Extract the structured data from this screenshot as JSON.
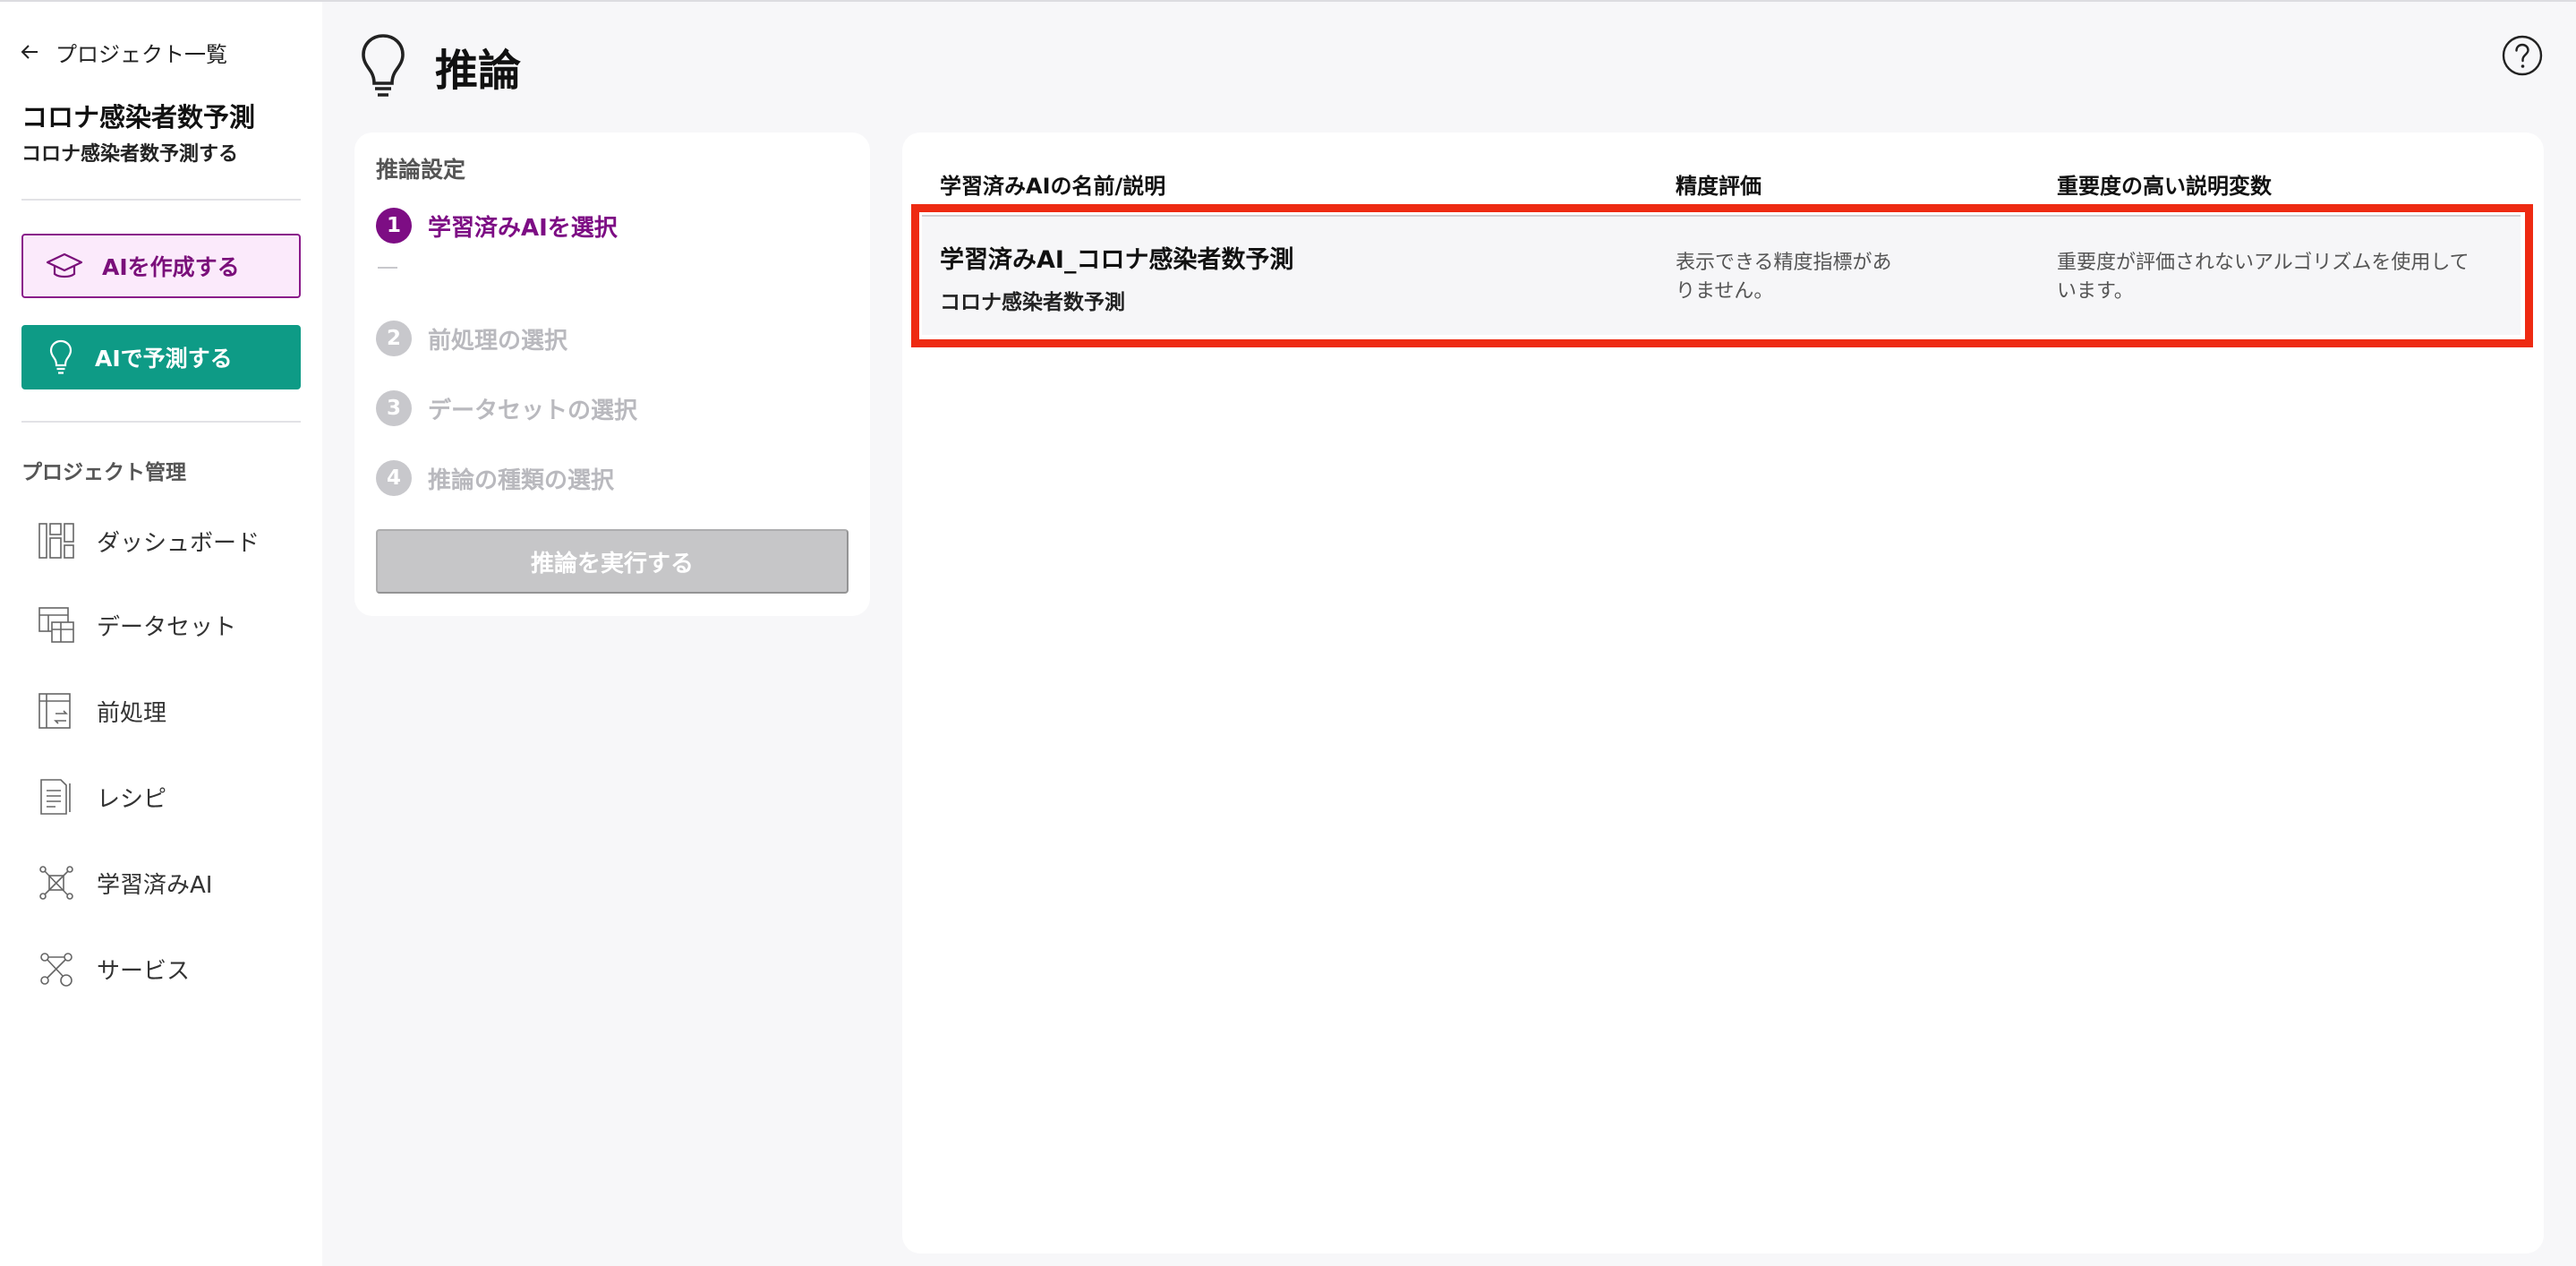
{
  "sidebar": {
    "back_label": "プロジェクト一覧",
    "project_name": "コロナ感染者数予測",
    "project_description": "コロナ感染者数予測する",
    "create_ai_label": "AIを作成する",
    "predict_ai_label": "AIで予測する",
    "section_label": "プロジェクト管理",
    "nav": [
      {
        "label": "ダッシュボード",
        "icon": "dashboard-icon"
      },
      {
        "label": "データセット",
        "icon": "dataset-icon"
      },
      {
        "label": "前処理",
        "icon": "preprocess-icon"
      },
      {
        "label": "レシピ",
        "icon": "recipe-icon"
      },
      {
        "label": "学習済みAI",
        "icon": "trained-ai-icon"
      },
      {
        "label": "サービス",
        "icon": "service-icon"
      }
    ]
  },
  "header": {
    "title": "推論",
    "icon": "lightbulb-icon"
  },
  "settings": {
    "title": "推論設定",
    "steps": [
      {
        "num": "1",
        "label": "学習済みAIを選択",
        "state": "active"
      },
      {
        "num": "2",
        "label": "前処理の選択",
        "state": "inactive"
      },
      {
        "num": "3",
        "label": "データセットの選択",
        "state": "inactive"
      },
      {
        "num": "4",
        "label": "推論の種類の選択",
        "state": "inactive"
      }
    ],
    "run_label": "推論を実行する"
  },
  "models_table": {
    "columns": [
      "学習済みAIの名前/説明",
      "精度評価",
      "重要度の高い説明変数"
    ],
    "rows": [
      {
        "name": "学習済みAI_コロナ感染者数予測",
        "description": "コロナ感染者数予測",
        "accuracy_line1": "表示できる精度指標があ",
        "accuracy_line2": "りません。",
        "importance_line1": "重要度が評価されないアルゴリズムを使用して",
        "importance_line2": "います。"
      }
    ]
  },
  "colors": {
    "accent_purple": "#7d0d84",
    "teal": "#0e9b86",
    "highlight_red": "#ee2a12"
  }
}
